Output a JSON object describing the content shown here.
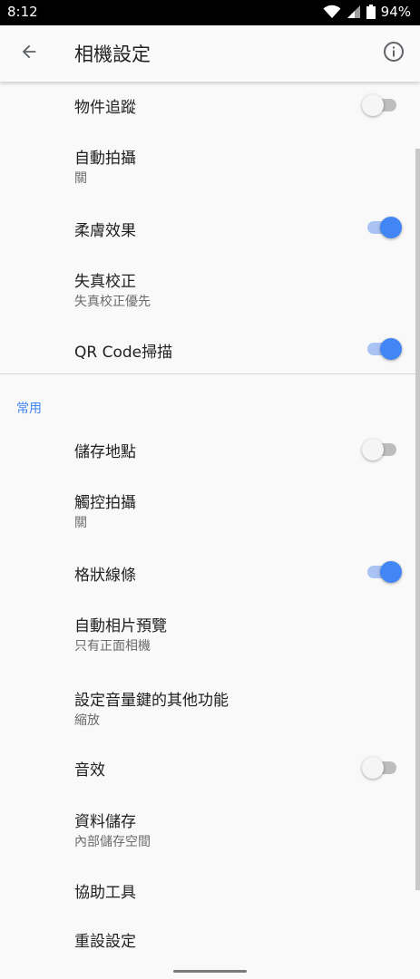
{
  "status_bar": {
    "time": "8:12",
    "battery": "94%",
    "icons": [
      "wifi-icon",
      "cell-signal-icon",
      "battery-icon"
    ]
  },
  "app_bar": {
    "title": "相機設定",
    "back_icon": "arrow-left-icon",
    "info_icon": "info-icon"
  },
  "settings": {
    "object_tracking": {
      "title": "物件追蹤",
      "enabled": false
    },
    "auto_capture": {
      "title": "自動拍攝",
      "value": "關"
    },
    "soft_effect": {
      "title": "柔膚效果",
      "enabled": true
    },
    "distortion_correction": {
      "title": "失真校正",
      "value": "失真校正優先"
    },
    "qr_code_scan": {
      "title": "QR Code掃描",
      "enabled": true
    }
  },
  "common_section": {
    "header": "常用",
    "storage_location": {
      "title": "儲存地點",
      "enabled": false
    },
    "touch_capture": {
      "title": "觸控拍攝",
      "value": "關"
    },
    "grid_lines": {
      "title": "格狀線條",
      "enabled": true
    },
    "auto_photo_preview": {
      "title": "自動相片預覽",
      "value": "只有正面相機"
    },
    "volume_key_function": {
      "title": "設定音量鍵的其他功能",
      "value": "縮放"
    },
    "sound_effects": {
      "title": "音效",
      "enabled": false
    },
    "data_storage": {
      "title": "資料儲存",
      "value": "內部儲存空間"
    },
    "accessibility": {
      "title": "協助工具"
    },
    "reset_settings": {
      "title": "重設設定"
    }
  },
  "colors": {
    "accent": "#4285f4",
    "toggle_on_track": "#a9c3f5",
    "toggle_off_track": "#bdbdbd",
    "background": "#f9f9f9"
  }
}
